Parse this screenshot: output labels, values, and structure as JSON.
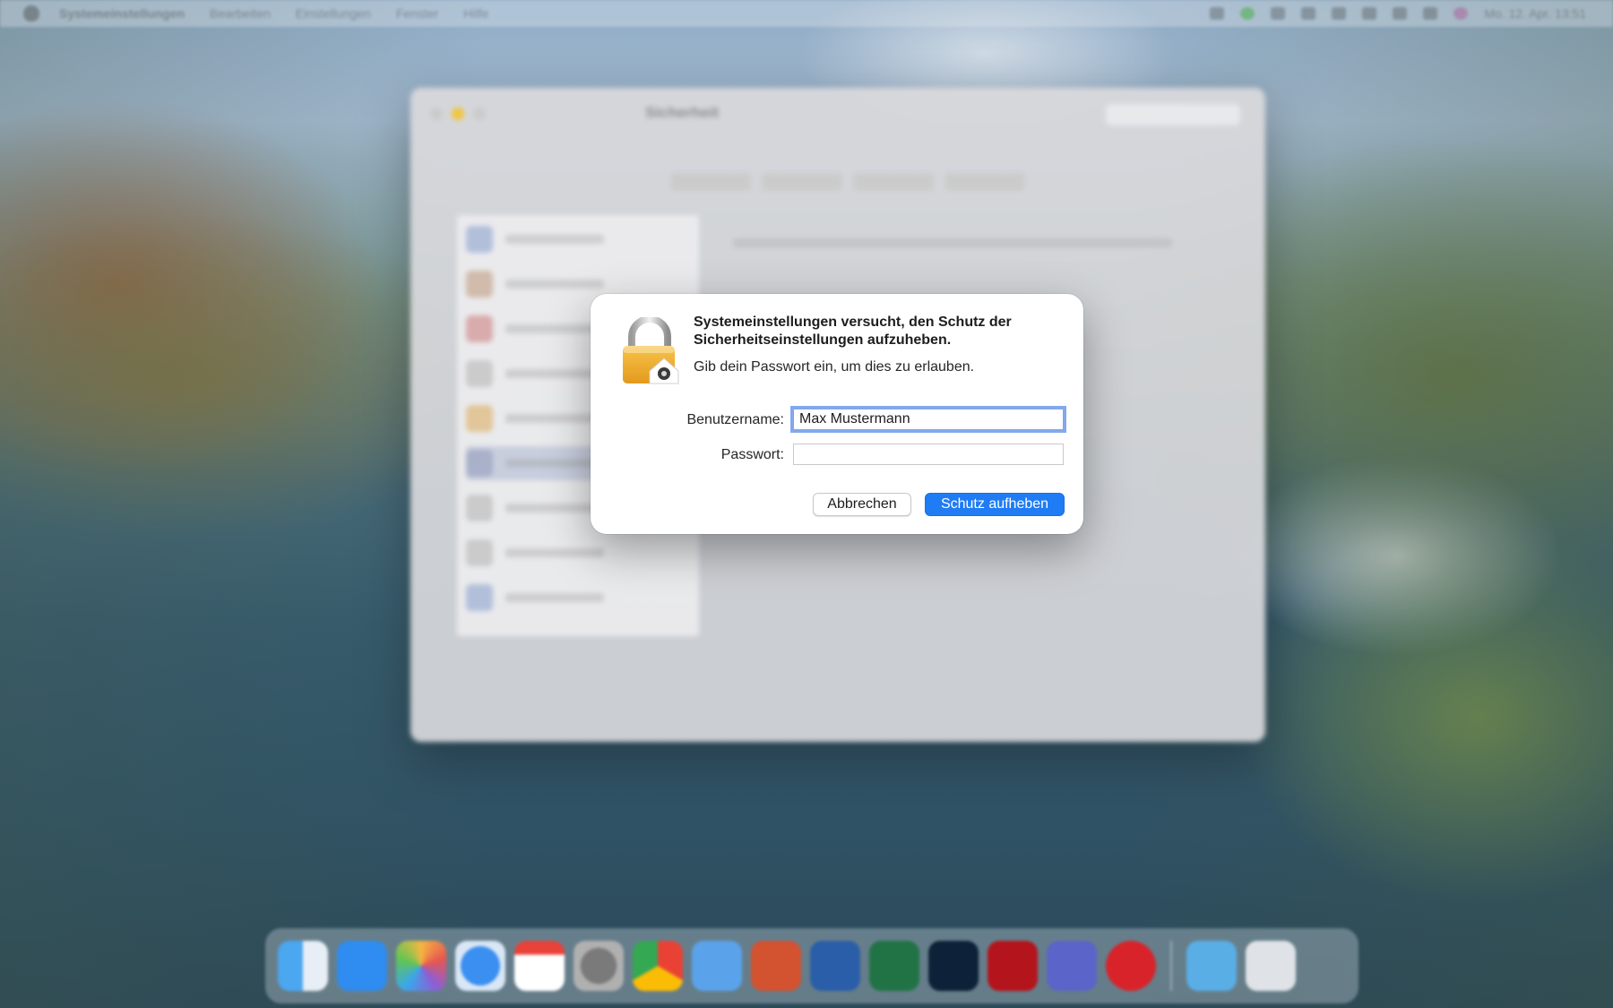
{
  "menubar": {
    "app_name": "Systemeinstellungen",
    "items": [
      "Bearbeiten",
      "Einstellungen",
      "Fenster",
      "Hilfe"
    ],
    "clock": "Mo. 12. Apr. 13:51"
  },
  "background_window": {
    "title": "Sicherheit"
  },
  "dialog": {
    "title": "Systemeinstellungen versucht, den Schutz der Sicherheitseinstellungen aufzuheben.",
    "message": "Gib dein Passwort ein, um dies zu erlauben.",
    "username_label": "Benutzername:",
    "username_value": "Max Mustermann",
    "password_label": "Passwort:",
    "password_value": "",
    "cancel_label": "Abbrechen",
    "confirm_label": "Schutz aufheben",
    "icon": "lock-icon"
  },
  "dock": {
    "apps": [
      "finder-icon",
      "app-store-icon",
      "photos-icon",
      "safari-icon",
      "calendar-icon",
      "system-preferences-icon",
      "chrome-icon",
      "mail-icon",
      "powerpoint-icon",
      "word-icon",
      "excel-icon",
      "photoshop-icon",
      "acrobat-icon",
      "teams-icon",
      "activity-monitor-icon",
      "downloads-folder-icon",
      "trash-icon"
    ]
  },
  "colors": {
    "accent": "#1f7cf5",
    "focus_ring": "#5a8ce6",
    "dialog_bg": "#ffffff"
  }
}
